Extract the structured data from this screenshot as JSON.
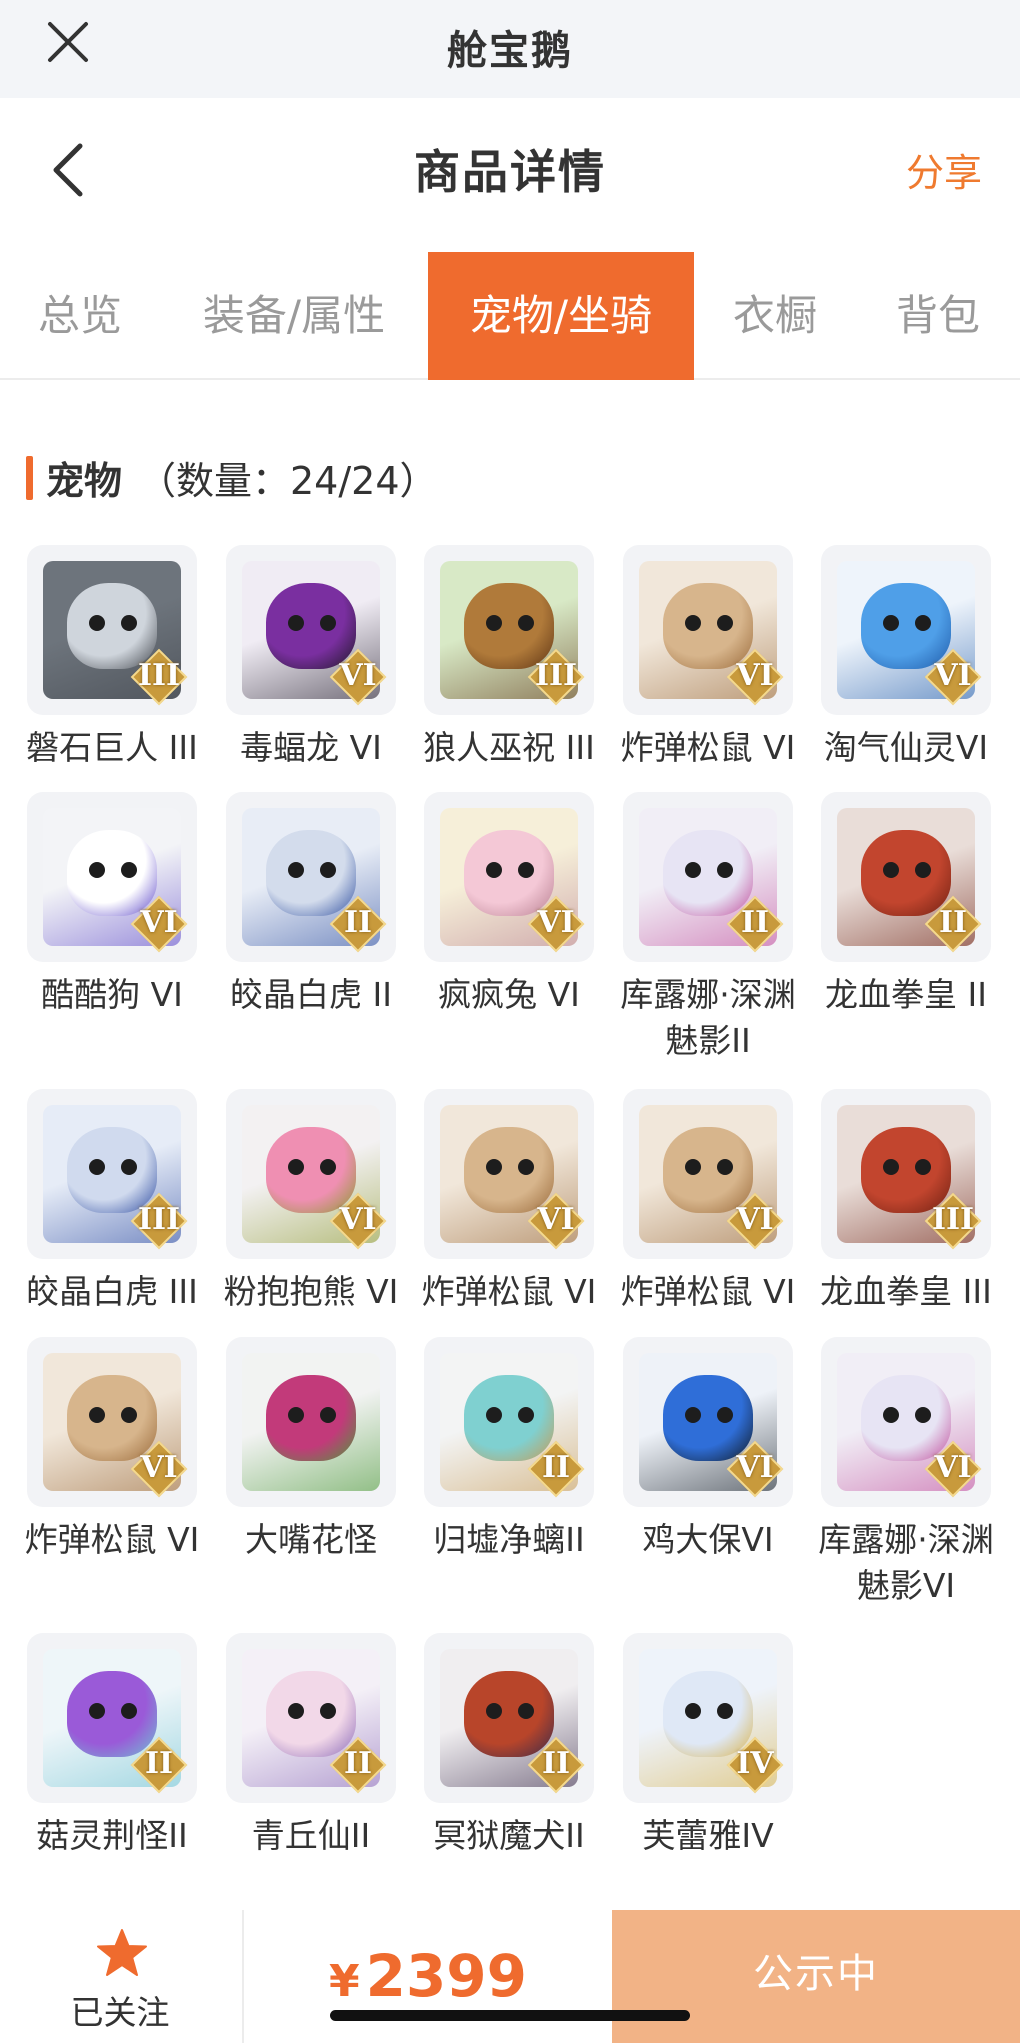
{
  "app_bar": {
    "title": "舱宝鹅",
    "close_icon": "close-icon"
  },
  "nav": {
    "title": "商品详情",
    "share_label": "分享",
    "back_icon": "chevron-left-icon"
  },
  "tabs": [
    {
      "label": "总览",
      "active": false
    },
    {
      "label": "装备/属性",
      "active": false
    },
    {
      "label": "宠物/坐骑",
      "active": true
    },
    {
      "label": "衣橱",
      "active": false
    },
    {
      "label": "背包",
      "active": false
    }
  ],
  "section": {
    "label": "宠物",
    "count_text": "（数量：24/24）"
  },
  "pets": [
    {
      "name": "磐石巨人 III",
      "rank": "III",
      "colors": [
        "#6d747c",
        "#cfd5dc",
        "#3e4249"
      ]
    },
    {
      "name": "毒蝠龙 VI",
      "rank": "VI",
      "colors": [
        "#f0ecf4",
        "#7a2fa0",
        "#1e1826"
      ]
    },
    {
      "name": "狼人巫祝 III",
      "rank": "III",
      "colors": [
        "#d8e9c6",
        "#b07a3a",
        "#5e3414"
      ]
    },
    {
      "name": "炸弹松鼠 VI",
      "rank": "VI",
      "colors": [
        "#f1e7da",
        "#d7b58c",
        "#9a6a3a"
      ]
    },
    {
      "name": "淘气仙灵VI",
      "rank": "VI",
      "colors": [
        "#eef4fb",
        "#4f9fe8",
        "#1f5aa8"
      ]
    },
    {
      "name": "酷酷狗 VI",
      "rank": "VI",
      "colors": [
        "#f3f4f7",
        "#ffffff",
        "#5b46c8"
      ]
    },
    {
      "name": "皎晶白虎 II",
      "rank": "II",
      "colors": [
        "#e8edf6",
        "#d3dcec",
        "#2f4fa0"
      ]
    },
    {
      "name": "疯疯兔 VI",
      "rank": "VI",
      "colors": [
        "#f6efd9",
        "#f4c8d6",
        "#b77f90"
      ]
    },
    {
      "name": "库露娜·深渊魅影II",
      "rank": "II",
      "colors": [
        "#f1eef6",
        "#e7e4f4",
        "#c04a9a"
      ]
    },
    {
      "name": "龙血拳皇 II",
      "rank": "II",
      "colors": [
        "#e9ddd8",
        "#c2452e",
        "#6e2012"
      ]
    },
    {
      "name": "皎晶白虎 III",
      "rank": "III",
      "colors": [
        "#e6ecf7",
        "#d0daee",
        "#2c4aa0"
      ]
    },
    {
      "name": "粉抱抱熊 VI",
      "rank": "VI",
      "colors": [
        "#f3f1f2",
        "#ef8fb2",
        "#8c9a2e"
      ]
    },
    {
      "name": "炸弹松鼠 VI",
      "rank": "VI",
      "colors": [
        "#f1e7da",
        "#d7b58c",
        "#9a6a3a"
      ]
    },
    {
      "name": "炸弹松鼠 VI",
      "rank": "VI",
      "colors": [
        "#f1e7da",
        "#d7b58c",
        "#9a6a3a"
      ]
    },
    {
      "name": "龙血拳皇 III",
      "rank": "III",
      "colors": [
        "#e9ddd8",
        "#c2452e",
        "#6e2012"
      ]
    },
    {
      "name": "炸弹松鼠 VI",
      "rank": "VI",
      "colors": [
        "#f1e7da",
        "#d7b58c",
        "#9a6a3a"
      ]
    },
    {
      "name": "大嘴花怪",
      "rank": "",
      "colors": [
        "#f2f3f2",
        "#c23a7a",
        "#4d9a3a"
      ]
    },
    {
      "name": "归墟净螭II",
      "rank": "II",
      "colors": [
        "#f3f4f4",
        "#7fd0d0",
        "#c79a54"
      ]
    },
    {
      "name": "鸡大保VI",
      "rank": "VI",
      "colors": [
        "#eef2f8",
        "#2f6ed8",
        "#101820"
      ]
    },
    {
      "name": "库露娜·深渊魅影VI",
      "rank": "VI",
      "colors": [
        "#f1eef6",
        "#e7e4f4",
        "#c04a9a"
      ]
    },
    {
      "name": "菇灵荆怪II",
      "rank": "II",
      "colors": [
        "#eef6f9",
        "#9a5ad8",
        "#6fc2d2"
      ]
    },
    {
      "name": "青丘仙II",
      "rank": "II",
      "colors": [
        "#f4f0f7",
        "#f2d8e8",
        "#8a6ab8"
      ]
    },
    {
      "name": "冥狱魔犬II",
      "rank": "II",
      "colors": [
        "#f0eef0",
        "#b8452a",
        "#3a2a4a"
      ]
    },
    {
      "name": "芙蕾雅IV",
      "rank": "IV",
      "colors": [
        "#eef3fa",
        "#dfe8f6",
        "#d8b24a"
      ]
    }
  ],
  "footer": {
    "follow_label": "已关注",
    "star_icon": "star-icon",
    "currency": "¥",
    "price": "2399",
    "status_label": "公示中",
    "accent": "#ef6b2e"
  }
}
